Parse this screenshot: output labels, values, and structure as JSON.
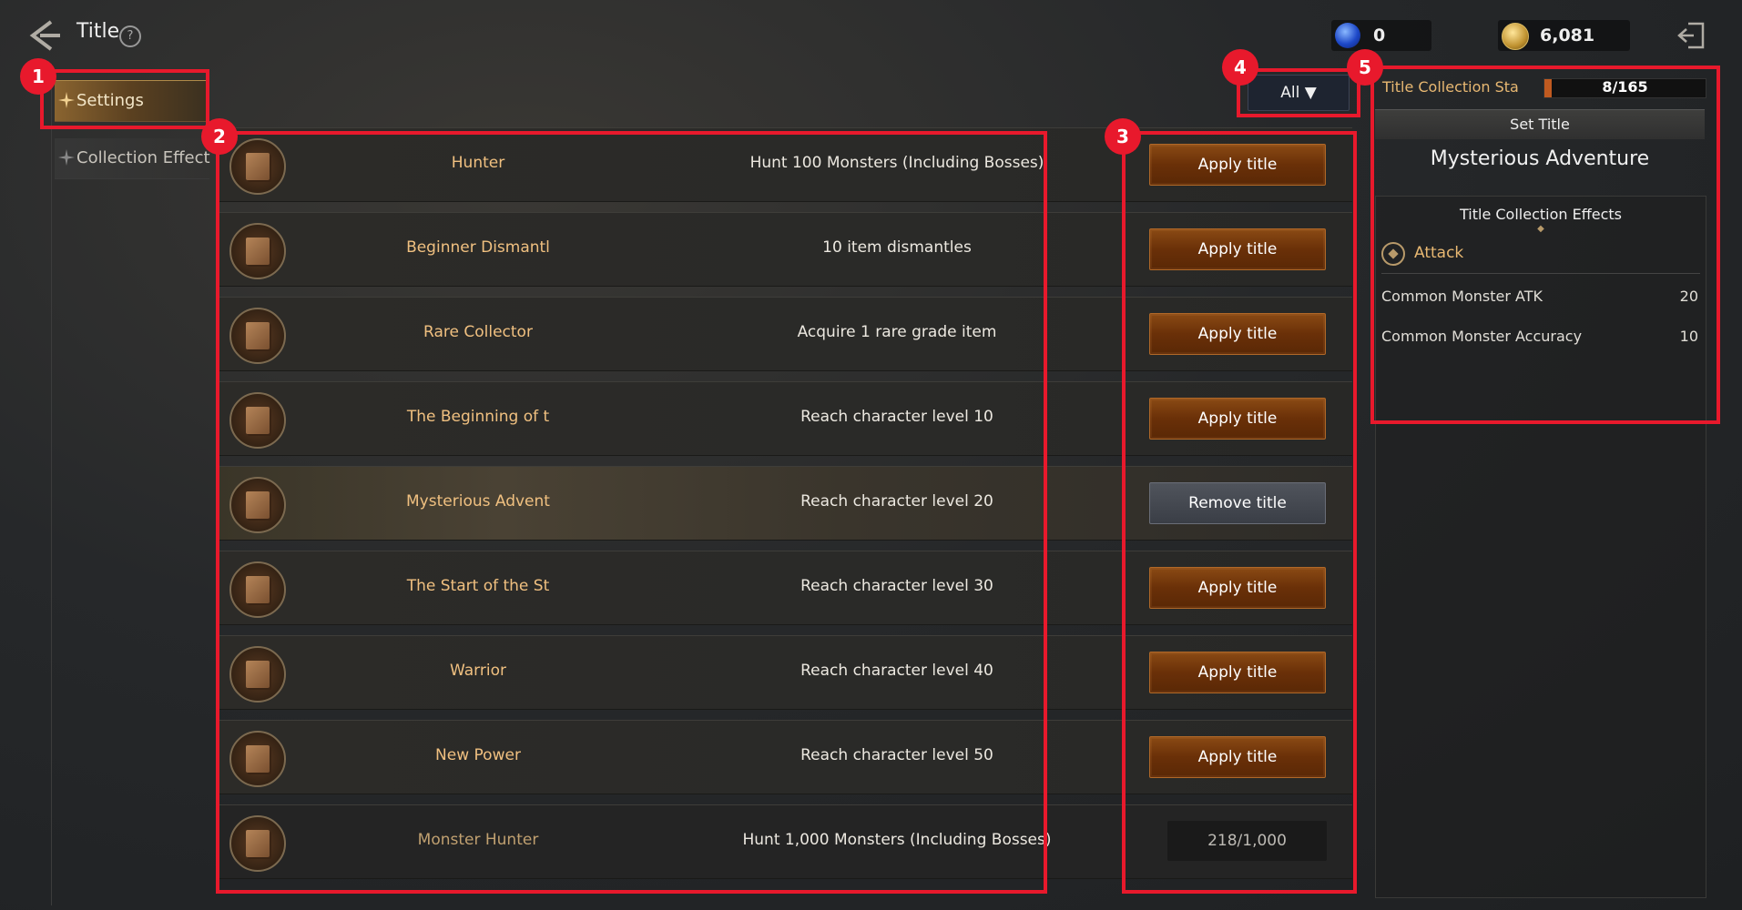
{
  "header": {
    "title": "Title",
    "help": "?",
    "gem_count": "0",
    "gold_count": "6,081"
  },
  "sidebar": {
    "tabs": [
      {
        "label": "Settings"
      },
      {
        "label": "Collection Effect"
      }
    ]
  },
  "filter": {
    "label": "All ▼"
  },
  "titles": [
    {
      "name": "Hunter",
      "condition": "Hunt 100 Monsters (Including Bosses)",
      "action": "Apply title"
    },
    {
      "name": "Beginner Dismantl",
      "condition": "10 item dismantles",
      "action": "Apply title"
    },
    {
      "name": "Rare Collector",
      "condition": "Acquire 1 rare grade item",
      "action": "Apply title"
    },
    {
      "name": "The Beginning of t",
      "condition": "Reach character level 10",
      "action": "Apply title"
    },
    {
      "name": "Mysterious Advent",
      "condition": "Reach character level 20",
      "action": "Remove title"
    },
    {
      "name": "The Start of the St",
      "condition": "Reach character level 30",
      "action": "Apply title"
    },
    {
      "name": "Warrior",
      "condition": "Reach character level 40",
      "action": "Apply title"
    },
    {
      "name": "New Power",
      "condition": "Reach character level 50",
      "action": "Apply title"
    },
    {
      "name": "Monster Hunter",
      "condition": "Hunt 1,000 Monsters (Including Bosses)",
      "action": "218/1,000"
    }
  ],
  "panel": {
    "stat_label": "Title Collection Sta",
    "stat_value": "8/165",
    "stat_fraction": 0.048,
    "set_title_label": "Set Title",
    "current_title": "Mysterious Adventure",
    "effects_header": "Title Collection Effects",
    "category": "Attack",
    "effects": [
      {
        "name": "Common Monster ATK",
        "value": "20"
      },
      {
        "name": "Common Monster Accuracy",
        "value": "10"
      }
    ]
  },
  "callouts": [
    "1",
    "2",
    "3",
    "4",
    "5"
  ],
  "colors": {
    "accent_orange": "#8a4a14",
    "title_gold": "#f0c080",
    "callout_red": "#e8192c"
  }
}
